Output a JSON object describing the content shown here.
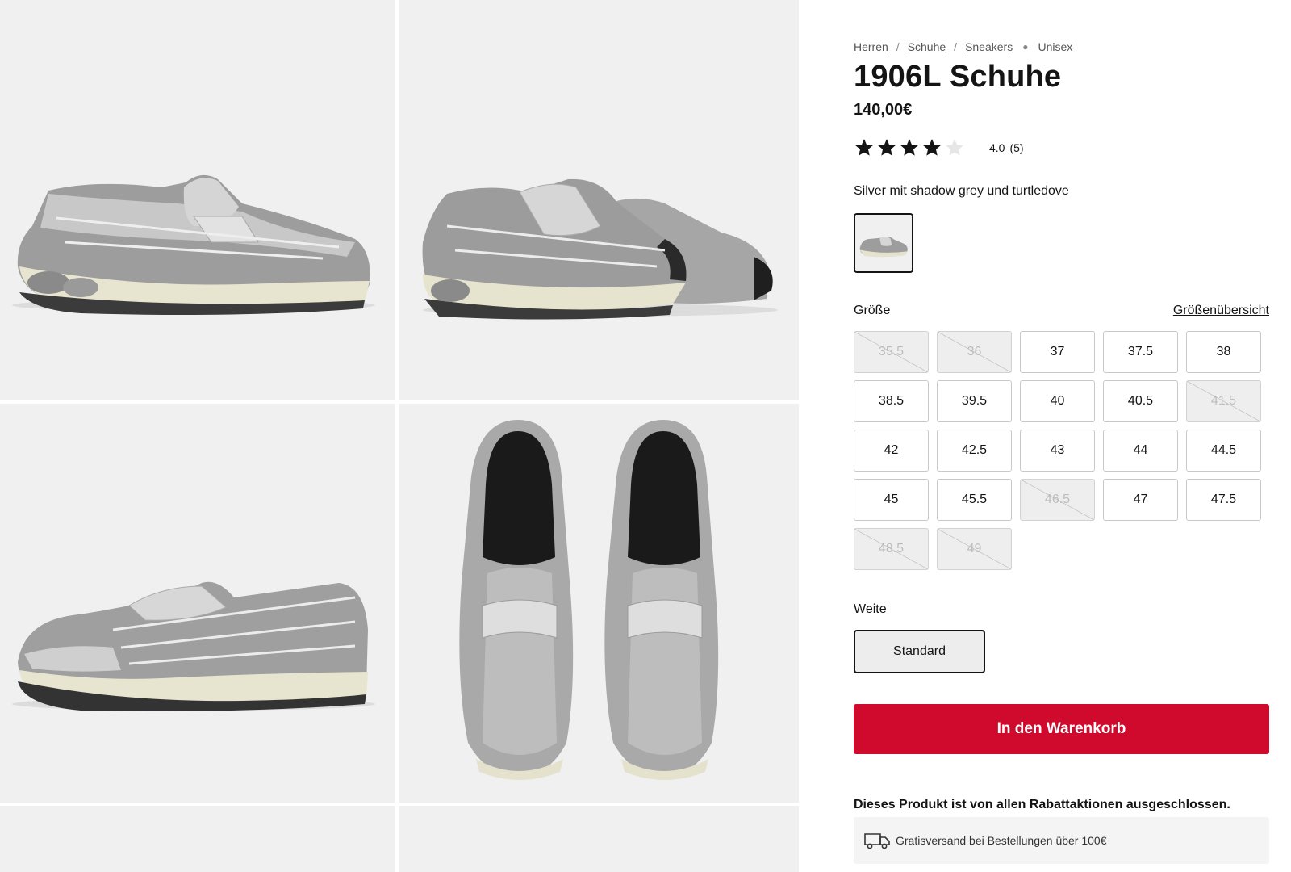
{
  "breadcrumb": {
    "items": [
      "Herren",
      "Schuhe",
      "Sneakers"
    ],
    "current": "Unisex"
  },
  "product": {
    "title": "1906L Schuhe",
    "price": "140,00€",
    "rating_value": "4.0",
    "rating_count": "(5)",
    "rating_stars": 4,
    "color_name": "Silver mit shadow grey und turtledove"
  },
  "size": {
    "label": "Größe",
    "chart_link": "Größenübersicht",
    "options": [
      {
        "label": "35.5",
        "available": false
      },
      {
        "label": "36",
        "available": false
      },
      {
        "label": "37",
        "available": true
      },
      {
        "label": "37.5",
        "available": true
      },
      {
        "label": "38",
        "available": true
      },
      {
        "label": "38.5",
        "available": true
      },
      {
        "label": "39.5",
        "available": true
      },
      {
        "label": "40",
        "available": true
      },
      {
        "label": "40.5",
        "available": true
      },
      {
        "label": "41.5",
        "available": false
      },
      {
        "label": "42",
        "available": true
      },
      {
        "label": "42.5",
        "available": true
      },
      {
        "label": "43",
        "available": true
      },
      {
        "label": "44",
        "available": true
      },
      {
        "label": "44.5",
        "available": true
      },
      {
        "label": "45",
        "available": true
      },
      {
        "label": "45.5",
        "available": true
      },
      {
        "label": "46.5",
        "available": false
      },
      {
        "label": "47",
        "available": true
      },
      {
        "label": "47.5",
        "available": true
      },
      {
        "label": "48.5",
        "available": false
      },
      {
        "label": "49",
        "available": false
      }
    ]
  },
  "width": {
    "label": "Weite",
    "selected": "Standard"
  },
  "cart_button": "In den Warenkorb",
  "notice": "Dieses Produkt ist von allen Rabattaktionen ausgeschlossen.",
  "shipping": {
    "icon": "truck-icon",
    "text": "Gratisversand bei Bestellungen über 100€"
  },
  "colors": {
    "accent": "#cf0a2c",
    "text": "#151415",
    "tile_bg": "#f0f0f0"
  }
}
